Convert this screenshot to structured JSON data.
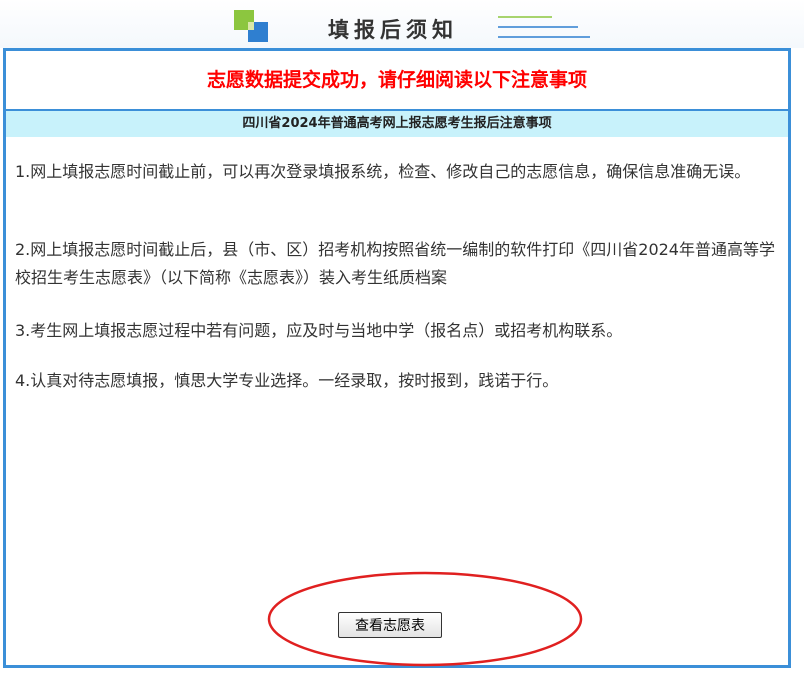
{
  "header": {
    "title": "填报后须知",
    "logo_icon": "colored-squares-icon",
    "decoration": "header-lines"
  },
  "panel": {
    "heading": "志愿数据提交成功，请仔细阅读以下注意事项",
    "subtitle": "四川省2024年普通高考网上报志愿考生报后注意事项",
    "notices": [
      "1.网上填报志愿时间截止前，可以再次登录填报系统，检查、修改自己的志愿信息，确保信息准确无误。",
      "2.网上填报志愿时间截止后，县（市、区）招考机构按照省统一编制的软件打印《四川省2024年普通高等学校招生考生志愿表》（以下简称《志愿表》）装入考生纸质档案",
      "3.考生网上填报志愿过程中若有问题，应及时与当地中学（报名点）或招考机构联系。",
      "4.认真对待志愿填报，慎思大学专业选择。一经录取，按时报到，践诺于行。"
    ],
    "view_button_label": "查看志愿表"
  },
  "colors": {
    "heading_red": "#ff0000",
    "panel_border": "#3b8fd8",
    "subtitle_bg": "#c8f2fb",
    "annotation_ellipse": "#e02020"
  }
}
